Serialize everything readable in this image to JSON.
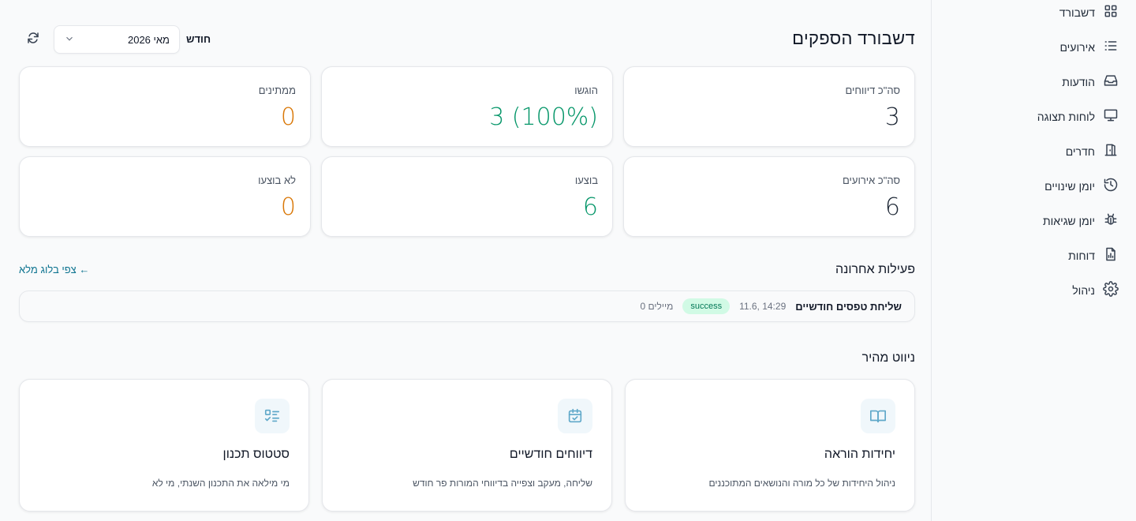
{
  "sidebar": {
    "items": [
      {
        "label": "דשבורד",
        "icon": "dashboard-grid-icon"
      },
      {
        "label": "אירועים",
        "icon": "list-icon"
      },
      {
        "label": "הודעות",
        "icon": "inbox-icon"
      },
      {
        "label": "לוחות תצוגה",
        "icon": "monitor-icon"
      },
      {
        "label": "חדרים",
        "icon": "door-icon"
      },
      {
        "label": "יומן שינויים",
        "icon": "history-icon"
      },
      {
        "label": "יומן שגיאות",
        "icon": "bug-icon"
      },
      {
        "label": "דוחות",
        "icon": "report-icon"
      },
      {
        "label": "ניהול",
        "icon": "gear-icon"
      }
    ]
  },
  "header": {
    "title": "דשבורד הספקים",
    "month_label": "חודש",
    "month_value": "מאי 2026"
  },
  "stats": {
    "total_reports": {
      "label": "סה\"כ דיווחים",
      "value": "3"
    },
    "submitted": {
      "label": "הוגשו",
      "value": "3 (100%)"
    },
    "pending": {
      "label": "ממתינים",
      "value": "0"
    },
    "total_events": {
      "label": "סה\"כ אירועים",
      "value": "6"
    },
    "done": {
      "label": "בוצעו",
      "value": "6"
    },
    "not_done": {
      "label": "לא בוצעו",
      "value": "0"
    }
  },
  "activity": {
    "title": "פעילות אחרונה",
    "full_log_link": "צפי בלוג מלא ←",
    "rows": [
      {
        "name": "שליחת טפסים חודשיים",
        "time": "11.6, 14:29",
        "status": "success",
        "count": "0 מיילים"
      }
    ]
  },
  "quick_nav": {
    "title": "ניווט מהיר",
    "cards": [
      {
        "title": "יחידות הוראה",
        "desc": "ניהול היחידות של כל מורה והנושאים המתוכננים",
        "icon": "book-open-icon"
      },
      {
        "title": "דיווחים חודשיים",
        "desc": "שליחה, מעקב וצפייה בדיווחי המורות פר חודש",
        "icon": "calendar-check-icon"
      },
      {
        "title": "סטטוס תכנון",
        "desc": "מי מילאה את התכנון השנתי, מי לא",
        "icon": "checklist-icon"
      }
    ]
  },
  "colors": {
    "accent_green": "#059669",
    "accent_orange": "#d97706",
    "link": "#0e7490",
    "badge_bg": "#d1fae5"
  }
}
